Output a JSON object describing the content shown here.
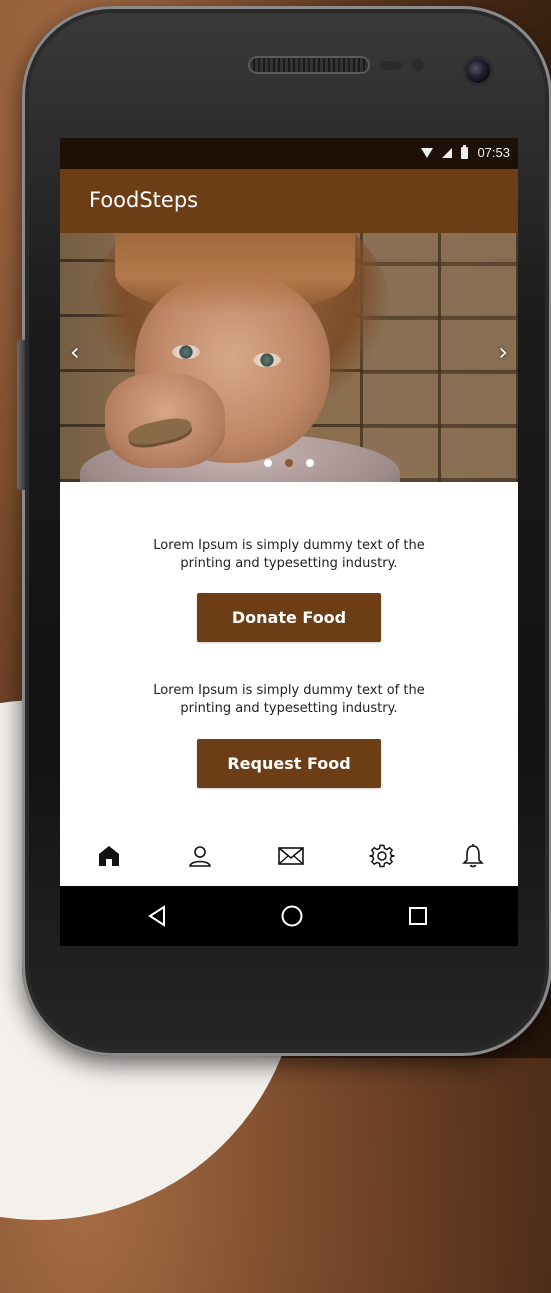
{
  "status_bar": {
    "time": "07:53",
    "icons": [
      "wifi-icon",
      "signal-icon",
      "battery-icon"
    ]
  },
  "app_bar": {
    "title": "FoodSteps",
    "color": "#6d3e16"
  },
  "carousel": {
    "prev_icon": "‹",
    "next_icon": "›",
    "slide_count": 3,
    "active_index": 1
  },
  "main": {
    "donate_section": {
      "description": "Lorem Ipsum is simply dummy text of the printing and typesetting industry.",
      "button_label": "Donate Food"
    },
    "request_section": {
      "description": "Lorem Ipsum is simply dummy text of the printing and typesetting industry.",
      "button_label": "Request Food"
    }
  },
  "bottom_nav": {
    "items": [
      "home-icon",
      "profile-icon",
      "mail-icon",
      "settings-icon",
      "notifications-icon"
    ],
    "active": "home-icon"
  },
  "system_nav": {
    "items": [
      "back-icon",
      "home-circle-icon",
      "recents-icon"
    ]
  },
  "colors": {
    "accent": "#6d3e16",
    "status_bar": "#1e1007",
    "dot_active": "#8a5a30"
  }
}
